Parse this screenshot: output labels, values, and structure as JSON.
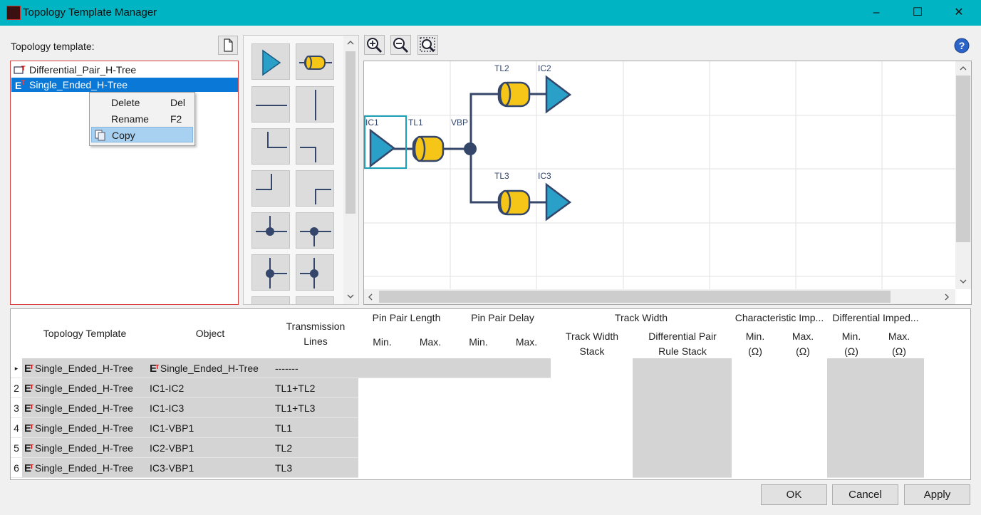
{
  "window": {
    "title": "Topology Template Manager",
    "controls": {
      "minimize": "–",
      "maximize": "☐",
      "close": "✕"
    }
  },
  "left": {
    "label": "Topology template:",
    "templates": [
      {
        "name": "Differential_Pair_H-Tree",
        "selected": false
      },
      {
        "name": "Single_Ended_H-Tree",
        "selected": true
      }
    ]
  },
  "context_menu": {
    "items": [
      {
        "label": "Delete",
        "shortcut": "Del",
        "highlighted": false
      },
      {
        "label": "Rename",
        "shortcut": "F2",
        "highlighted": false
      },
      {
        "label": "Copy",
        "shortcut": "",
        "highlighted": true
      }
    ]
  },
  "diagram": {
    "labels": {
      "ic1": "IC1",
      "tl1": "TL1",
      "vbp": "VBP",
      "tl2": "TL2",
      "ic2": "IC2",
      "tl3": "TL3",
      "ic3": "IC3"
    }
  },
  "table": {
    "headers": {
      "topology_template": "Topology Template",
      "object": "Object",
      "transmission_lines": "Transmission Lines",
      "pin_pair_length": "Pin Pair Length",
      "pin_pair_delay": "Pin Pair Delay",
      "track_width": "Track Width",
      "characteristic_imp": "Characteristic Imp...",
      "differential_imped": "Differential Imped...",
      "min": "Min.",
      "max": "Max.",
      "min_ohm": "Min. (Ω)",
      "max_ohm": "Max. (Ω)",
      "track_width_stack": "Track Width Stack",
      "differential_pair_rule_stack": "Differential Pair Rule Stack"
    },
    "rows": [
      {
        "index": "",
        "template": "Single_Ended_H-Tree",
        "object": "Single_Ended_H-Tree",
        "lines": "-------",
        "object_icon": true
      },
      {
        "index": "2",
        "template": "Single_Ended_H-Tree",
        "object": "IC1-IC2",
        "lines": "TL1+TL2",
        "object_icon": false
      },
      {
        "index": "3",
        "template": "Single_Ended_H-Tree",
        "object": "IC1-IC3",
        "lines": "TL1+TL3",
        "object_icon": false
      },
      {
        "index": "4",
        "template": "Single_Ended_H-Tree",
        "object": "IC1-VBP1",
        "lines": "TL1",
        "object_icon": false
      },
      {
        "index": "5",
        "template": "Single_Ended_H-Tree",
        "object": "IC2-VBP1",
        "lines": "TL2",
        "object_icon": false
      },
      {
        "index": "6",
        "template": "Single_Ended_H-Tree",
        "object": "IC3-VBP1",
        "lines": "TL3",
        "object_icon": false
      }
    ]
  },
  "buttons": {
    "ok": "OK",
    "cancel": "Cancel",
    "apply": "Apply"
  },
  "icons": {
    "new": "new-template-icon",
    "zoom_in": "zoom-in-icon",
    "zoom_out": "zoom-out-icon",
    "zoom_fit": "zoom-fit-icon",
    "help": "help-icon"
  },
  "colors": {
    "titlebar": "#00b4c3",
    "selection": "#0a78d7",
    "ic_fill": "#2aa0c8",
    "tl_fill": "#f5c518",
    "wire": "#34466a"
  }
}
